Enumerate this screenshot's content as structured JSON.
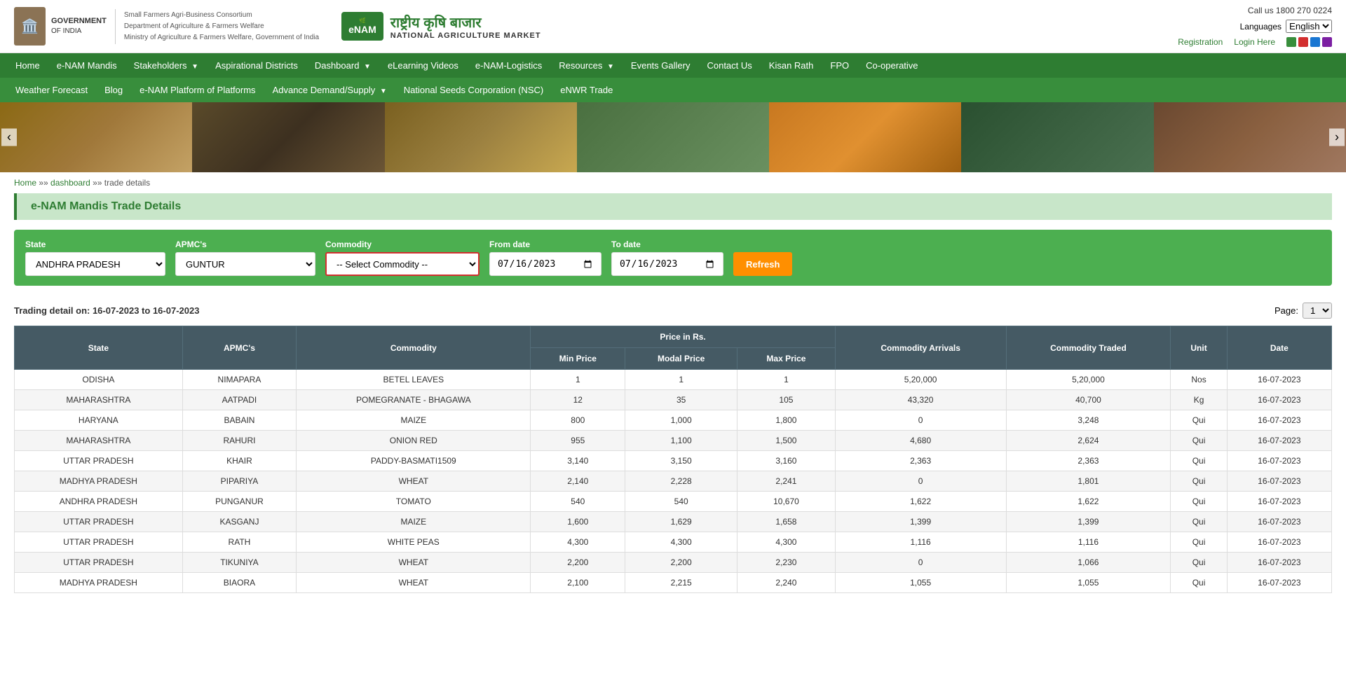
{
  "header": {
    "gov_title": "GOVERNMENT OF INDIA",
    "dept_line1": "Small Farmers Agri-Business Consortium",
    "dept_line2": "Department of Agriculture & Farmers Welfare",
    "dept_line3": "Ministry of Agriculture & Farmers Welfare, Government of India",
    "enam_badge": "eNAM",
    "enam_title_hi": "राष्ट्रीय कृषि बाजार",
    "enam_title_en": "NATIONAL AGRICULTURE MARKET",
    "call_us": "Call us 1800 270 0224",
    "languages_label": "Languages",
    "language_selected": "English",
    "registration_label": "Registration",
    "login_label": "Login Here"
  },
  "nav_primary": {
    "items": [
      {
        "label": "Home",
        "has_arrow": false
      },
      {
        "label": "e-NAM Mandis",
        "has_arrow": false
      },
      {
        "label": "Stakeholders",
        "has_arrow": true
      },
      {
        "label": "Aspirational Districts",
        "has_arrow": false
      },
      {
        "label": "Dashboard",
        "has_arrow": true
      },
      {
        "label": "eLearning Videos",
        "has_arrow": false
      },
      {
        "label": "e-NAM-Logistics",
        "has_arrow": false
      },
      {
        "label": "Resources",
        "has_arrow": true
      },
      {
        "label": "Events Gallery",
        "has_arrow": false
      },
      {
        "label": "Contact Us",
        "has_arrow": false
      },
      {
        "label": "Kisan Rath",
        "has_arrow": false
      },
      {
        "label": "FPO",
        "has_arrow": false
      },
      {
        "label": "Co-operative",
        "has_arrow": false
      }
    ]
  },
  "nav_secondary": {
    "items": [
      {
        "label": "Weather Forecast"
      },
      {
        "label": "Blog"
      },
      {
        "label": "e-NAM Platform of Platforms"
      },
      {
        "label": "Advance Demand/Supply",
        "has_arrow": true
      },
      {
        "label": "National Seeds Corporation (NSC)"
      },
      {
        "label": "eNWR Trade"
      }
    ]
  },
  "breadcrumb": {
    "home": "Home",
    "dashboard": "dashboard",
    "current": "trade details"
  },
  "page_title": "e-NAM Mandis Trade Details",
  "filters": {
    "state_label": "State",
    "state_value": "ANDHRA PRADESH",
    "apmc_label": "APMC's",
    "apmc_value": "GUNTUR",
    "commodity_label": "Commodity",
    "commodity_placeholder": "-- Select Commodity --",
    "from_date_label": "From date",
    "from_date_value": "16-07-2023",
    "to_date_label": "To date",
    "to_date_value": "16-07-2023",
    "refresh_label": "Refresh"
  },
  "trading_detail": {
    "info_text": "Trading detail on: 16-07-2023 to 16-07-2023",
    "page_label": "Page:",
    "page_value": "1"
  },
  "table": {
    "headers": [
      "State",
      "APMC's",
      "Commodity",
      "Price in Rs.",
      "Commodity Arrivals",
      "Commodity Traded",
      "Unit",
      "Date"
    ],
    "price_sub_headers": [
      "Min Price",
      "Modal Price",
      "Max Price"
    ],
    "rows": [
      {
        "state": "ODISHA",
        "apmc": "NIMAPARA",
        "commodity": "BETEL LEAVES",
        "min_price": "1",
        "modal_price": "1",
        "max_price": "1",
        "arrivals": "5,20,000",
        "traded": "5,20,000",
        "unit": "Nos",
        "date": "16-07-2023"
      },
      {
        "state": "MAHARASHTRA",
        "apmc": "AATPADI",
        "commodity": "POMEGRANATE - BHAGAWA",
        "min_price": "12",
        "modal_price": "35",
        "max_price": "105",
        "arrivals": "43,320",
        "traded": "40,700",
        "unit": "Kg",
        "date": "16-07-2023"
      },
      {
        "state": "HARYANA",
        "apmc": "BABAIN",
        "commodity": "MAIZE",
        "min_price": "800",
        "modal_price": "1,000",
        "max_price": "1,800",
        "arrivals": "0",
        "traded": "3,248",
        "unit": "Qui",
        "date": "16-07-2023"
      },
      {
        "state": "MAHARASHTRA",
        "apmc": "RAHURI",
        "commodity": "ONION RED",
        "min_price": "955",
        "modal_price": "1,100",
        "max_price": "1,500",
        "arrivals": "4,680",
        "traded": "2,624",
        "unit": "Qui",
        "date": "16-07-2023"
      },
      {
        "state": "UTTAR PRADESH",
        "apmc": "KHAIR",
        "commodity": "PADDY-BASMATI1509",
        "min_price": "3,140",
        "modal_price": "3,150",
        "max_price": "3,160",
        "arrivals": "2,363",
        "traded": "2,363",
        "unit": "Qui",
        "date": "16-07-2023"
      },
      {
        "state": "MADHYA PRADESH",
        "apmc": "PIPARIYA",
        "commodity": "WHEAT",
        "min_price": "2,140",
        "modal_price": "2,228",
        "max_price": "2,241",
        "arrivals": "0",
        "traded": "1,801",
        "unit": "Qui",
        "date": "16-07-2023"
      },
      {
        "state": "ANDHRA PRADESH",
        "apmc": "PUNGANUR",
        "commodity": "TOMATO",
        "min_price": "540",
        "modal_price": "540",
        "max_price": "10,670",
        "arrivals": "1,622",
        "traded": "1,622",
        "unit": "Qui",
        "date": "16-07-2023"
      },
      {
        "state": "UTTAR PRADESH",
        "apmc": "KASGANJ",
        "commodity": "MAIZE",
        "min_price": "1,600",
        "modal_price": "1,629",
        "max_price": "1,658",
        "arrivals": "1,399",
        "traded": "1,399",
        "unit": "Qui",
        "date": "16-07-2023"
      },
      {
        "state": "UTTAR PRADESH",
        "apmc": "RATH",
        "commodity": "WHITE PEAS",
        "min_price": "4,300",
        "modal_price": "4,300",
        "max_price": "4,300",
        "arrivals": "1,116",
        "traded": "1,116",
        "unit": "Qui",
        "date": "16-07-2023"
      },
      {
        "state": "UTTAR PRADESH",
        "apmc": "TIKUNIYA",
        "commodity": "WHEAT",
        "min_price": "2,200",
        "modal_price": "2,200",
        "max_price": "2,230",
        "arrivals": "0",
        "traded": "1,066",
        "unit": "Qui",
        "date": "16-07-2023"
      },
      {
        "state": "MADHYA PRADESH",
        "apmc": "BIAORA",
        "commodity": "WHEAT",
        "min_price": "2,100",
        "modal_price": "2,215",
        "max_price": "2,240",
        "arrivals": "1,055",
        "traded": "1,055",
        "unit": "Qui",
        "date": "16-07-2023"
      }
    ]
  },
  "colors": {
    "green_primary": "#2e7d32",
    "green_nav": "#4caf50",
    "orange_btn": "#ff8f00",
    "table_header": "#455a64",
    "red_border": "#d32f2f"
  }
}
